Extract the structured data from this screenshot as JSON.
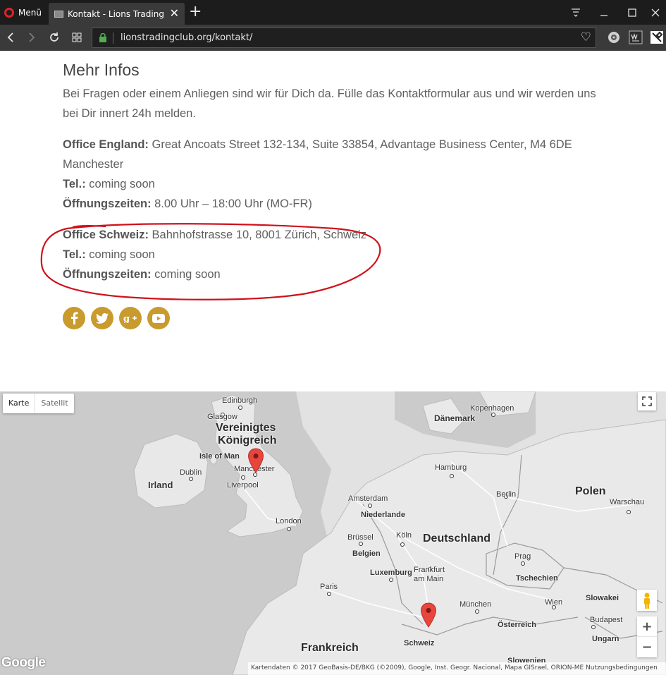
{
  "browser": {
    "menu_label": "Menü",
    "tab_title": "Kontakt - Lions Trading Club",
    "url": "lionstradingclub.org/kontakt/"
  },
  "page": {
    "title": "Mehr Infos",
    "intro": "Bei Fragen oder einem Anliegen sind wir für Dich da. Fülle das Kontaktformular aus und wir werden uns bei Dir innert 24h melden.",
    "england": {
      "office_label": "Office England:",
      "office_value": " Great Ancoats Street 132-134, Suite 33854, Advantage Business Center, M4 6DE Manchester",
      "tel_label": "Tel.:",
      "tel_value": " coming soon",
      "hours_label": "Öffnungszeiten:",
      "hours_value": " 8.00 Uhr – 18:00 Uhr (MO-FR)"
    },
    "schweiz": {
      "office_label": "Office Schweiz:",
      "office_value": " Bahnhofstrasse 10, 8001 Zürich, Schweiz",
      "tel_label": "Tel.:",
      "tel_value": " coming soon",
      "hours_label": "Öffnungszeiten:",
      "hours_value": " coming soon"
    },
    "socials": [
      {
        "name": "facebook",
        "glyph": "f"
      },
      {
        "name": "twitter",
        "glyph": "t"
      },
      {
        "name": "google-plus",
        "glyph": "g+"
      },
      {
        "name": "youtube",
        "glyph": "▶"
      }
    ],
    "accent_color": "#c99a2e",
    "annotation_color": "#d0111b"
  },
  "map": {
    "type_map": "Karte",
    "type_satellite": "Satellit",
    "zoom_in": "+",
    "zoom_out": "−",
    "logo": "Google",
    "attribution": "Kartendaten © 2017 GeoBasis-DE/BKG (©2009), Google, Inst. Geogr. Nacional, Mapa GISrael, ORION-ME    Nutzungsbedingungen",
    "labels": {
      "edinburgh": "Edinburgh",
      "glasgow": "Glasgow",
      "uk1": "Vereinigtes",
      "uk2": "Königreich",
      "isle_of_man": "Isle of Man",
      "dublin": "Dublin",
      "irland": "Irland",
      "manchester": "Manchester",
      "liverpool": "Liverpool",
      "london": "London",
      "kopenhagen": "Kopenhagen",
      "daenemark": "Dänemark",
      "hamburg": "Hamburg",
      "berlin": "Berlin",
      "polen": "Polen",
      "warschau": "Warschau",
      "amsterdam": "Amsterdam",
      "niederlande": "Niederlande",
      "bruessel": "Brüssel",
      "koeln": "Köln",
      "belgien": "Belgien",
      "deutschland": "Deutschland",
      "luxemburg": "Luxemburg",
      "frankfurt1": "Frankfurt",
      "frankfurt2": "am Main",
      "prag": "Prag",
      "tschechien": "Tschechien",
      "paris": "Paris",
      "muenchen": "München",
      "wien": "Wien",
      "slowakei": "Slowakei",
      "oesterreich": "Österreich",
      "budapest": "Budapest",
      "frankreich": "Frankreich",
      "schweiz": "Schweiz",
      "ungarn": "Ungarn",
      "slowenien": "Slowenien"
    },
    "marker_color": "#e8453c"
  }
}
